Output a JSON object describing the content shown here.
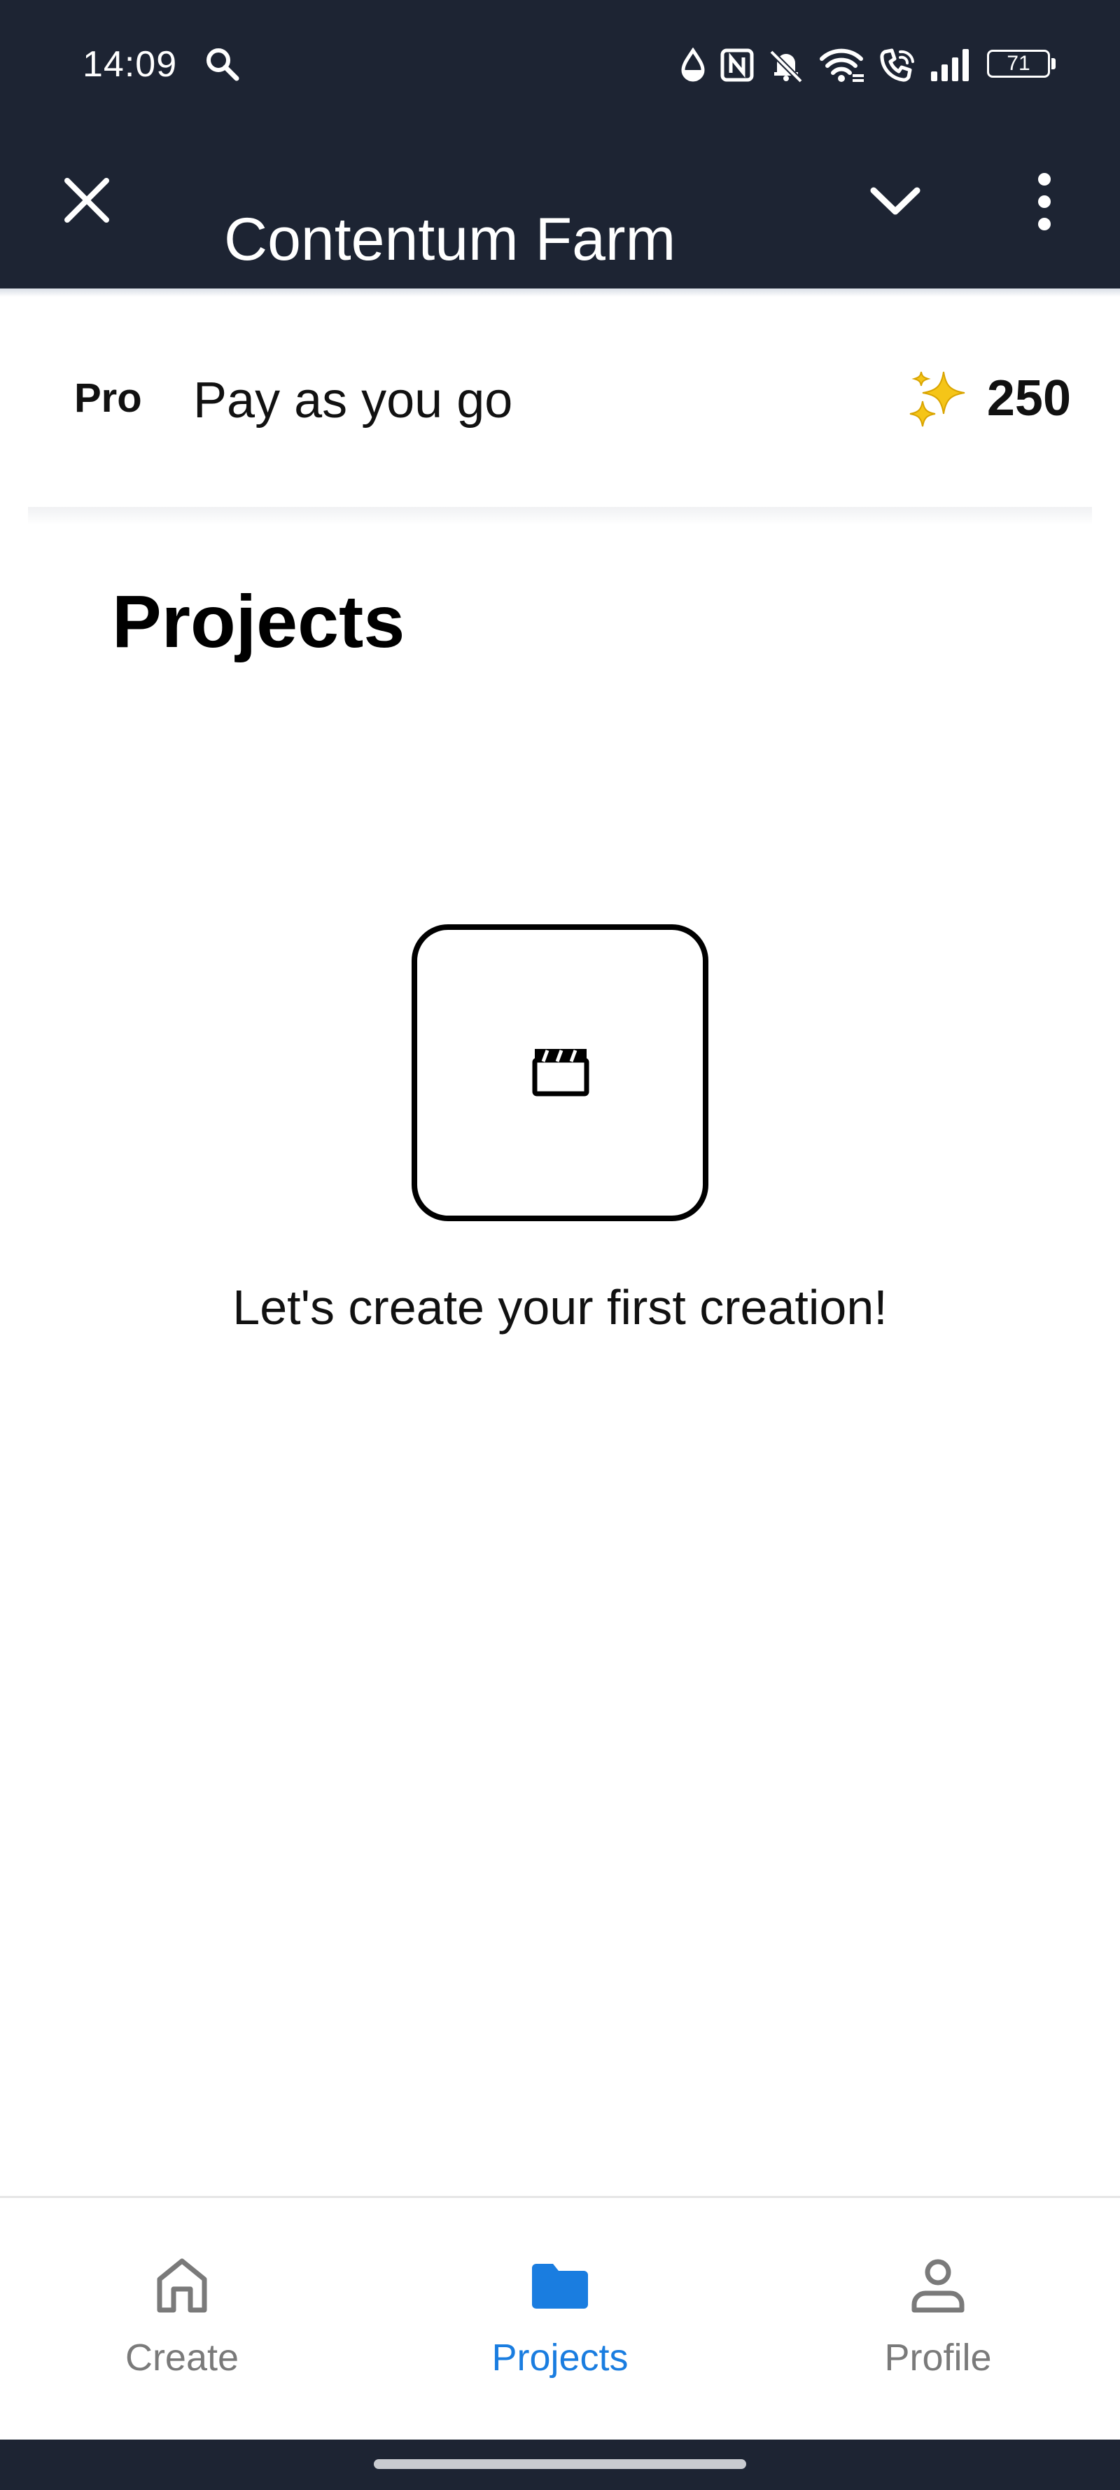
{
  "status_bar": {
    "time": "14:09",
    "battery_level": "71",
    "icons": [
      "search-icon",
      "water-drop-icon",
      "nfc-icon",
      "bell-off-icon",
      "wifi-icon",
      "wifi-calling-icon",
      "signal-icon",
      "battery-icon"
    ]
  },
  "header": {
    "title": "Contentum Farm",
    "close_icon": "close-icon",
    "dropdown_icon": "chevron-down-icon",
    "menu_icon": "more-vertical-icon"
  },
  "plan": {
    "badge": "Pro",
    "name": "Pay as you go",
    "credits_icon": "sparkle-icon",
    "credits": "250"
  },
  "main": {
    "title": "Projects",
    "empty_state": {
      "icon": "clapperboard-icon",
      "message": "Let's create your first creation!"
    }
  },
  "bottom_nav": {
    "items": [
      {
        "label": "Create",
        "icon": "home-icon",
        "active": false
      },
      {
        "label": "Projects",
        "icon": "folder-icon",
        "active": true
      },
      {
        "label": "Profile",
        "icon": "person-icon",
        "active": false
      }
    ]
  },
  "colors": {
    "header_bg": "#1d2433",
    "accent": "#1a7de0",
    "inactive": "#7a7a7a",
    "text": "#111111"
  }
}
